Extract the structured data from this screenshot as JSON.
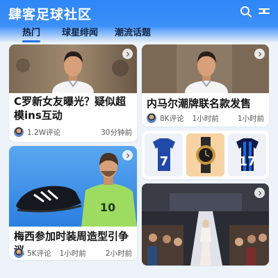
{
  "app": {
    "title": "肆客足球社区"
  },
  "tabs": [
    {
      "label": "热门",
      "active": true
    },
    {
      "label": "球星绯闻",
      "active": false
    },
    {
      "label": "潮流话题",
      "active": false
    }
  ],
  "cards": [
    {
      "title": "C罗新女友曝光？疑似超模ins互动",
      "comments": "1.2W评论",
      "time": "30分钟前"
    },
    {
      "title": "内马尔潮牌联名款发售",
      "comments": "8K评论",
      "time": "1小时前",
      "time2": "1小时前"
    },
    {
      "jersey_left_number": "7",
      "jersey_right_number": "17"
    },
    {
      "title": "梅西参加时装周造型引争议",
      "comments": "5K评论",
      "time": "1小时前",
      "time2": "2小时前",
      "boot_number": "10"
    },
    {
      "image": "fashion-runway"
    }
  ],
  "colors": {
    "header": "#2f86f6",
    "accent": "#1f6ff0",
    "background": "#eef3fa"
  }
}
